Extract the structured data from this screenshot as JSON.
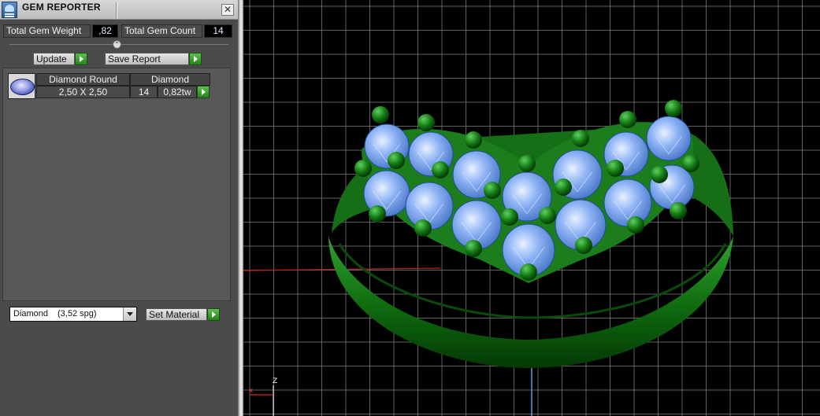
{
  "window": {
    "title": "GEM REPORTER",
    "close_glyph": "✕",
    "icon": "gem-reporter-app-icon"
  },
  "summary": {
    "weight_label": "Total Gem Weight",
    "weight_value": ",82",
    "count_label": "Total Gem Count",
    "count_value": "14"
  },
  "actions": {
    "update_label": "Update",
    "save_report_label": "Save Report",
    "expander_glyph": "⌃"
  },
  "gem_list": {
    "columns": [
      "Diamond Round",
      "Diamond"
    ],
    "rows": [
      {
        "thumbnail": "round-gem-icon",
        "size": "2,50 X 2,50",
        "count": "14",
        "weight": "0,82tw"
      }
    ]
  },
  "material": {
    "selected_name": "Diamond",
    "selected_spg": "(3,52 spg)",
    "set_label": "Set Material"
  },
  "viewport": {
    "axis_x_label": "x",
    "axis_z_label": "Z",
    "colors": {
      "grid": "#7a7a7a",
      "metal": "#1f7a1f",
      "gem": "#7aa6f0",
      "prong": "#0f5a0f",
      "x_axis": "#c02020",
      "z_axis": "#4aa8d8"
    }
  }
}
